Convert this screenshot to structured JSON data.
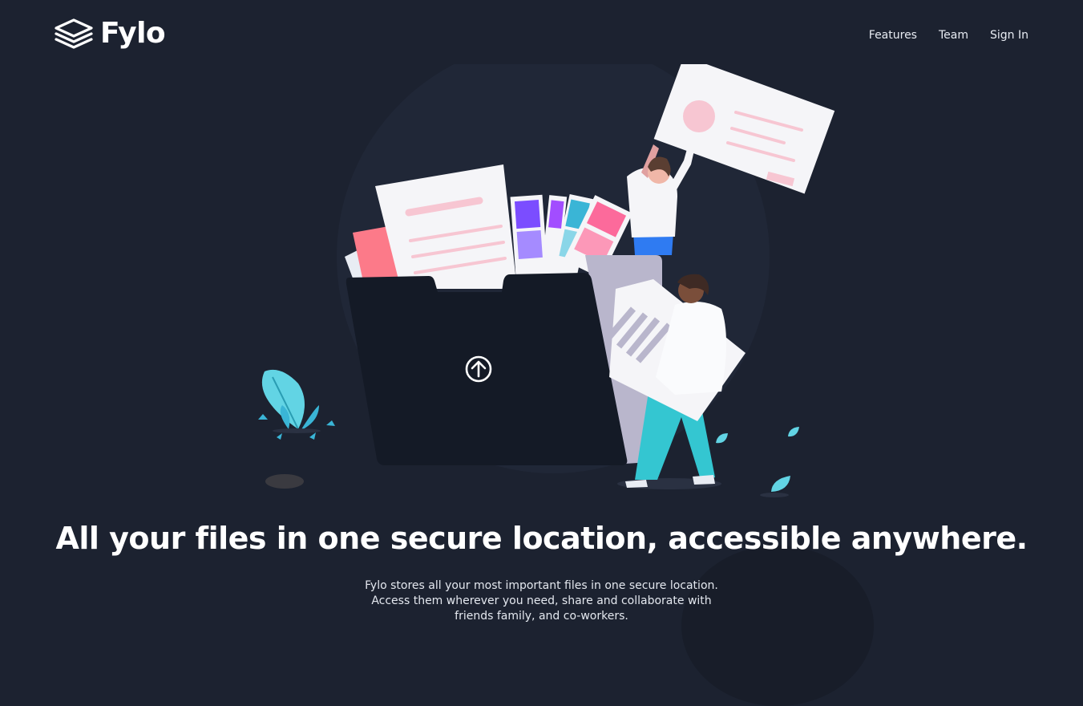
{
  "brand": {
    "name": "Fylo",
    "logo_icon": "stacked-layers-icon"
  },
  "nav": {
    "items": [
      {
        "label": "Features"
      },
      {
        "label": "Team"
      },
      {
        "label": "Sign In"
      }
    ]
  },
  "hero": {
    "illustration_icon": "upload-arrow-icon",
    "headline": "All your files in one secure location, accessible anywhere.",
    "description": "Fylo stores all your most important files in one secure location. Access them wherever you need, share and collaborate with friends family, and co-workers."
  },
  "colors": {
    "background": "#1c2230",
    "folder": "#141a26",
    "accent_cyan": "#62d4e4",
    "accent_pink": "#fc6a9b"
  }
}
